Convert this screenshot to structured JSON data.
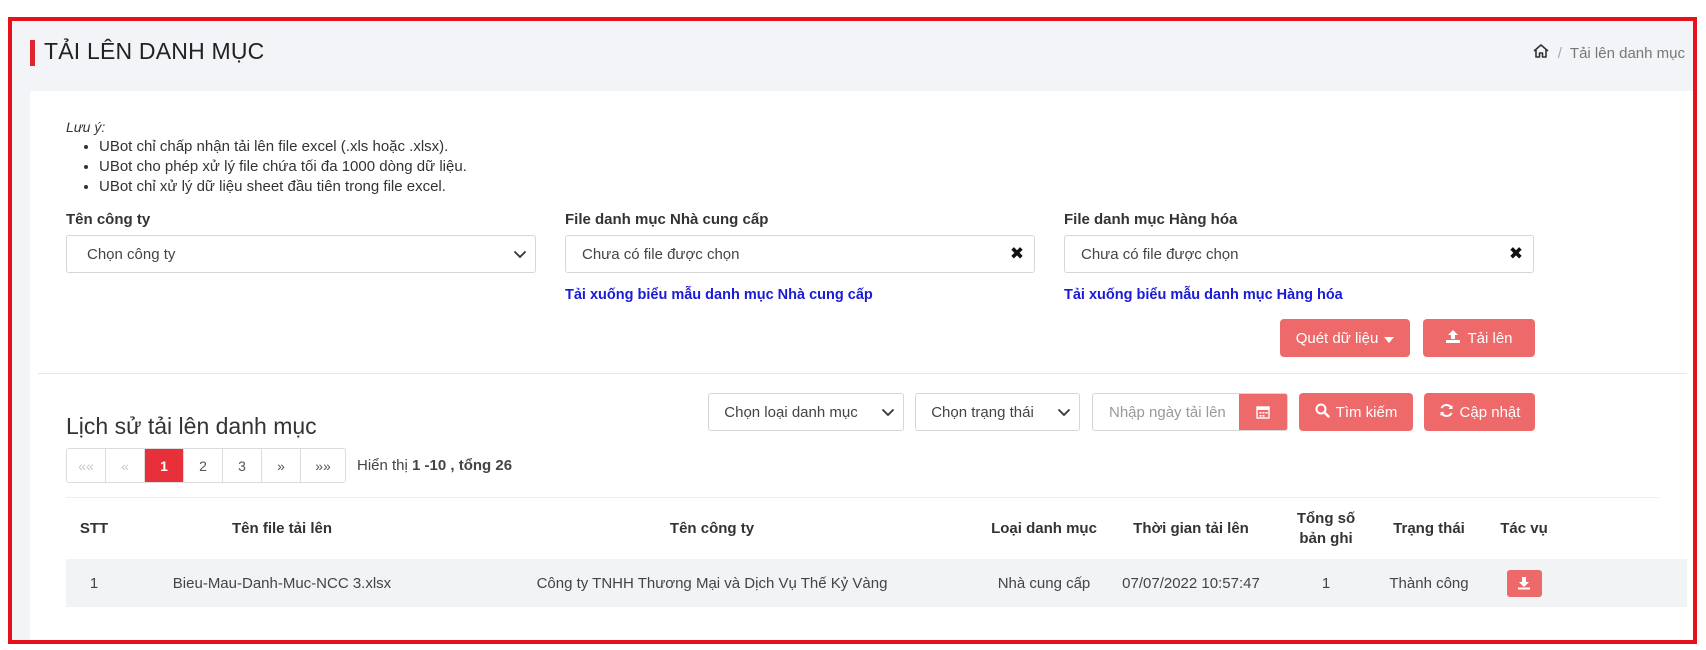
{
  "header": {
    "title": "TẢI LÊN DANH MỤC",
    "breadcrumb_icon": "home-icon",
    "breadcrumb_separator": "/",
    "breadcrumb_current": "Tải lên danh mục"
  },
  "note": {
    "title": "Lưu ý:",
    "items": [
      "UBot chỉ chấp nhận tải lên file excel (.xls hoặc .xlsx).",
      "UBot cho phép xử lý file chứa tối đa 1000 dòng dữ liệu.",
      "UBot chỉ xử lý dữ liệu sheet đầu tiên trong file excel."
    ]
  },
  "form": {
    "company_label": "Tên công ty",
    "company_value": "Chọn công ty",
    "supplier_file_label": "File danh mục Nhà cung cấp",
    "supplier_file_value": "Chưa có file được chọn",
    "goods_file_label": "File danh mục Hàng hóa",
    "goods_file_value": "Chưa có file được chọn",
    "clear_symbol": "✖",
    "supplier_template_link": "Tải xuống biểu mẫu danh mục Nhà cung cấp",
    "goods_template_link": "Tải xuống biểu mẫu danh mục Hàng hóa",
    "scan_button": "Quét dữ liệu",
    "upload_button": "Tải lên"
  },
  "history": {
    "title": "Lịch sử tải lên danh mục",
    "category_filter": "Chọn loại danh mục",
    "status_filter": "Chọn trạng thái",
    "date_placeholder": "Nhập ngày tải lên",
    "search_button": "Tìm kiếm",
    "refresh_button": "Cập nhật"
  },
  "pagination": {
    "first": "««",
    "prev": "«",
    "pages": [
      "1",
      "2",
      "3"
    ],
    "active_page": "1",
    "next": "»",
    "last": "»»",
    "info_prefix": "Hiển thị",
    "info_range": "1 -10 , tổng 26"
  },
  "table": {
    "columns": [
      "STT",
      "Tên file tải lên",
      "Tên công ty",
      "Loại danh mục",
      "Thời gian tải lên",
      "Tổng số bản ghi",
      "Trạng thái",
      "Tác vụ"
    ],
    "rows": [
      {
        "stt": "1",
        "file": "Bieu-Mau-Danh-Muc-NCC 3.xlsx",
        "company": "Công ty TNHH Thương Mại và Dịch Vụ Thế Kỷ Vàng",
        "category": "Nhà cung cấp",
        "time": "07/07/2022 10:57:47",
        "records": "1",
        "status": "Thành công",
        "action_icon": "download-icon"
      }
    ]
  },
  "colors": {
    "accent": "#e8303a",
    "button": "#ee6a6a",
    "link": "#1a1ad8",
    "frame_highlight": "#e8101a"
  }
}
